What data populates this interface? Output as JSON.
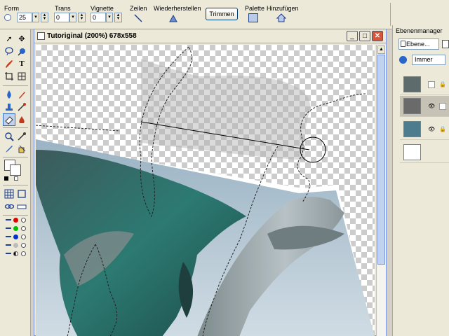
{
  "options_bar": {
    "form_label": "Form",
    "form_value": "25",
    "trans_label": "Trans",
    "trans_value": "0",
    "vignette_label": "Vignette",
    "vignette_value": "0",
    "zeilen_label": "Zeilen",
    "wiederherstellen_label": "Wiederherstellen",
    "trimmen_label": "Trimmen",
    "palette_label": "Palette",
    "hinzufuegen_label": "Hinzufügen"
  },
  "document": {
    "title": "Tutoriginal (200%) 678x558",
    "minimize_label": "_",
    "maximize_label": "□",
    "close_label": "✕"
  },
  "layers_panel": {
    "title": "Ebenenmanager",
    "tab_label": "Ebene...",
    "blend_mode": "Immer"
  },
  "icons": [
    "arrow-icon",
    "lasso-icon",
    "wand-icon",
    "crop-icon",
    "text-icon",
    "brush-icon",
    "stamp-icon",
    "eraser-icon",
    "zoom-icon",
    "eyedropper-icon",
    "fill-icon",
    "grid-icon",
    "eye-icon",
    "lock-icon"
  ],
  "colors": {
    "foreground": "#000000",
    "background": "#ffffff",
    "accent": "#316ac5"
  }
}
